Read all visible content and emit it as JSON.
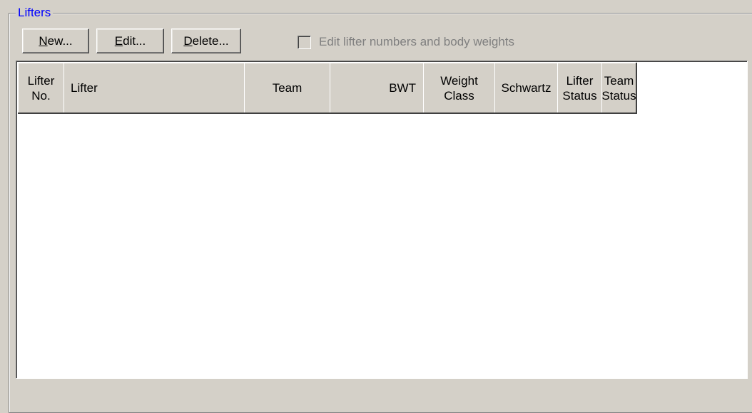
{
  "group": {
    "title": "Lifters"
  },
  "toolbar": {
    "new_label_accel": "N",
    "new_label_rest": "ew...",
    "edit_label_accel": "E",
    "edit_label_rest": "dit...",
    "delete_label_accel": "D",
    "delete_label_rest": "elete...",
    "checkbox_label": "Edit lifter numbers and body weights",
    "checkbox_checked": false,
    "checkbox_enabled": false
  },
  "table": {
    "columns": [
      {
        "line1": "Lifter",
        "line2": "No."
      },
      {
        "line1": "Lifter",
        "line2": ""
      },
      {
        "line1": "Team",
        "line2": ""
      },
      {
        "line1": "BWT",
        "line2": ""
      },
      {
        "line1": "Weight",
        "line2": "Class"
      },
      {
        "line1": "Schwartz",
        "line2": ""
      },
      {
        "line1": "Lifter",
        "line2": "Status"
      },
      {
        "line1": "Team",
        "line2": "Status"
      }
    ],
    "rows": []
  },
  "colors": {
    "window_bg": "#d4d0c8",
    "group_title": "#0000ff",
    "disabled_text": "#808080",
    "list_bg": "#ffffff"
  }
}
